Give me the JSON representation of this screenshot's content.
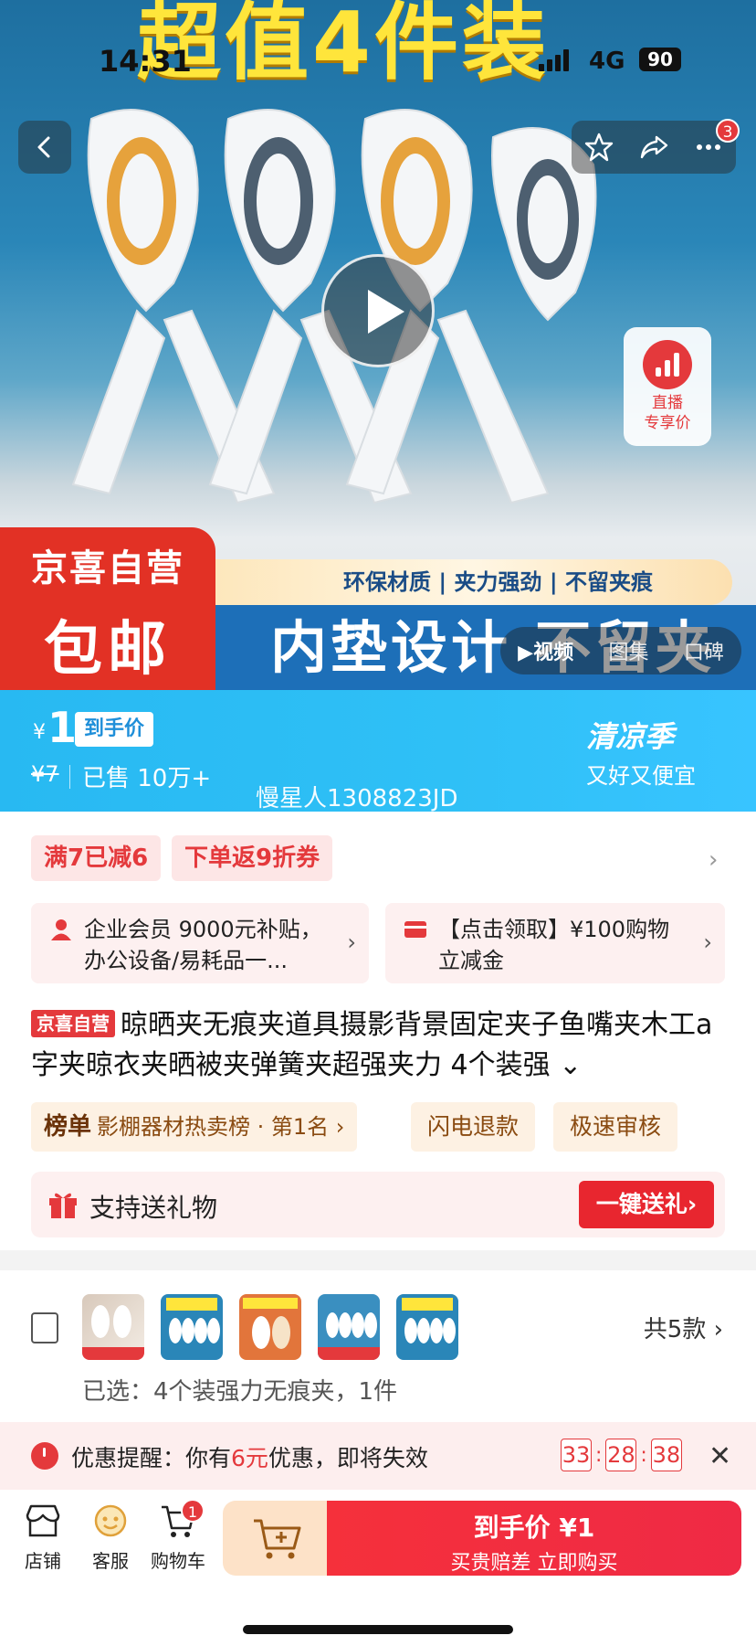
{
  "status_bar": {
    "time": "14:31",
    "network": "4G",
    "battery": "90"
  },
  "hero": {
    "banner_title": "超值4件装",
    "nav_badge_count": "3",
    "live": {
      "line1": "直播",
      "line2": "专享价"
    },
    "store_badge": {
      "line1": "京喜自营",
      "line2": "包邮"
    },
    "features": "环保材质 | 夹力强劲 | 不留夹痕",
    "slogan": "内垫设计 不留夹痕",
    "media_tabs": [
      "视频",
      "图集",
      "口碑"
    ]
  },
  "price": {
    "currency": "¥",
    "current": "1",
    "tag": "到手价",
    "original": "¥7",
    "sold": "已售 10万+",
    "watermark": "慢星人1308823JD",
    "season_title": "清凉季",
    "season_sub": "又好又便宜"
  },
  "promos": {
    "pill1": "满7已减6",
    "pill2": "下单返9折券",
    "box1": "企业会员 9000元补贴，办公设备/易耗品一...",
    "box2": "【点击领取】¥100购物立减金"
  },
  "product": {
    "badge": "京喜自营",
    "title": "晾晒夹无痕夹道具摄影背景固定夹子鱼嘴夹木工a字夹晾衣夹晒被夹弹簧夹超强夹力 4个装强",
    "rank_label": "榜单",
    "rank_text": "影棚器材热卖榜 · 第1名",
    "tag1": "闪电退款",
    "tag2": "极速审核",
    "gift_label": "支持送礼物",
    "gift_button": "一键送礼"
  },
  "sku": {
    "count": "共5款",
    "selected": "已选：4个装强力无痕夹，1件"
  },
  "reminder": {
    "prefix": "优惠提醒：你有",
    "amount": "6元",
    "suffix": "优惠，即将失效",
    "timer": [
      "33",
      "28",
      "38"
    ]
  },
  "bottom_bar": {
    "store": "店铺",
    "service": "客服",
    "cart": "购物车",
    "cart_badge": "1",
    "buy_line1": "到手价 ¥1",
    "buy_line2": "买贵赔差 立即购买"
  },
  "colors": {
    "accent_red": "#e4393c",
    "price_blue": "#2fc0f6",
    "hero_blue": "#1d6fb8"
  }
}
